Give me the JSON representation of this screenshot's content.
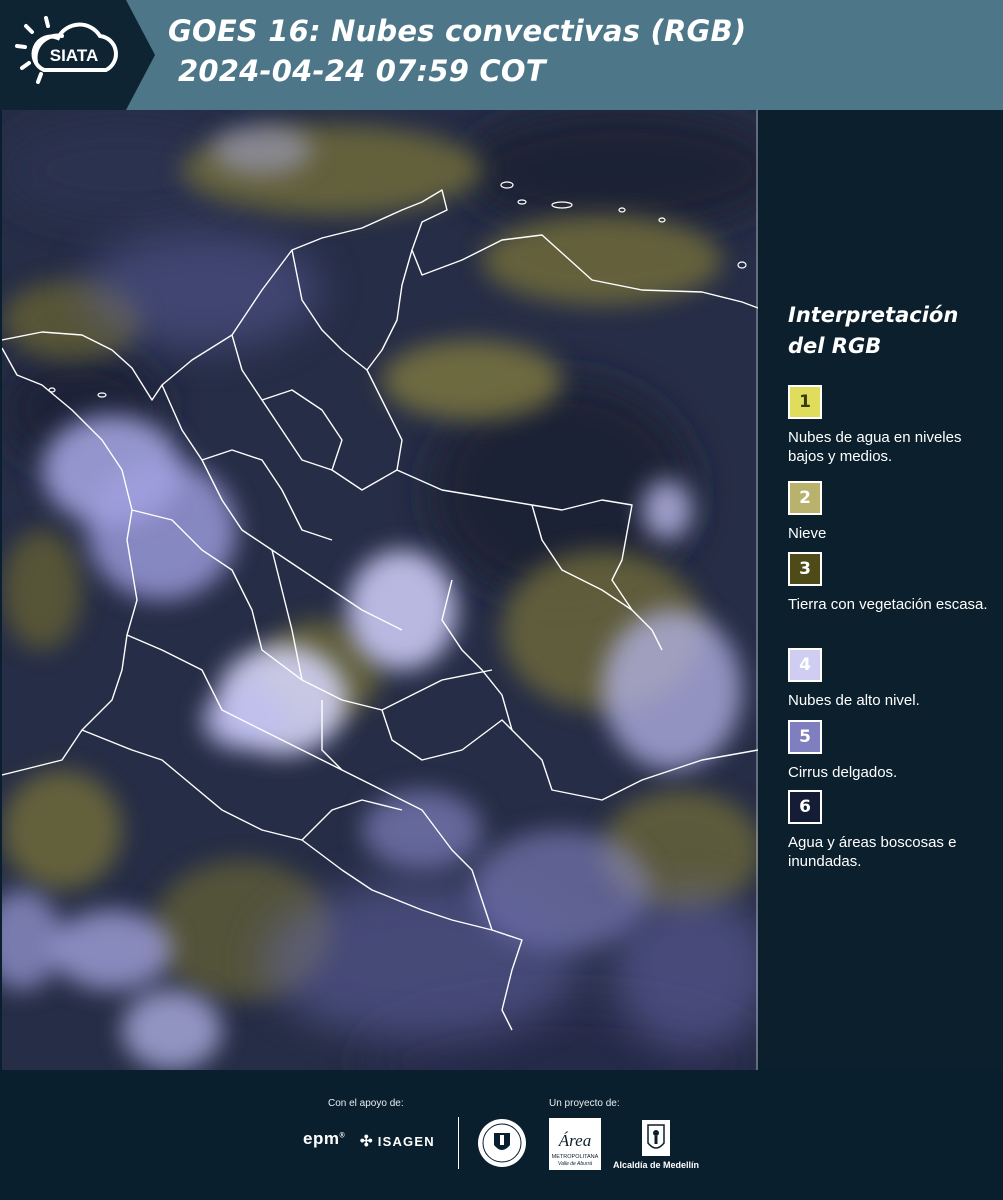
{
  "header": {
    "logo_text": "SIATA",
    "title_line1": "GOES 16: Nubes convectivas (RGB)",
    "title_line2": "2024-04-24 07:59 COT"
  },
  "legend": {
    "title": "Interpretación del RGB",
    "items": [
      {
        "number": "1",
        "label": "Nubes de agua en niveles bajos y medios.",
        "color": "#e0dc5c",
        "text_color": "#3a3a10"
      },
      {
        "number": "2",
        "label": "Nieve",
        "color": "#b9b26c",
        "text_color": "#ffffff"
      },
      {
        "number": "3",
        "label": "Tierra con vegetación escasa.",
        "color": "#4f4b19",
        "text_color": "#ffffff"
      },
      {
        "number": "4",
        "label": "Nubes de alto nivel.",
        "color": "#cfcdf1",
        "text_color": "#ffffff"
      },
      {
        "number": "5",
        "label": "Cirrus delgados.",
        "color": "#7f7ebe",
        "text_color": "#ffffff"
      },
      {
        "number": "6",
        "label": "Agua y áreas boscosas e inundadas.",
        "color": "#141c36",
        "text_color": "#ffffff"
      }
    ]
  },
  "footer": {
    "support_label": "Con el apoyo de:",
    "project_label": "Un proyecto de:",
    "sponsors": [
      "epm",
      "ISAGEN"
    ],
    "area_text": "Área",
    "area_sub1": "METROPOLITANA",
    "area_sub2": "Valle de Aburrá",
    "alcaldia": "Alcaldía de Medellín"
  },
  "colors": {
    "header_bg": "#4d7788",
    "logo_bg": "#0e2433",
    "panel_bg": "#0b1f2c"
  }
}
